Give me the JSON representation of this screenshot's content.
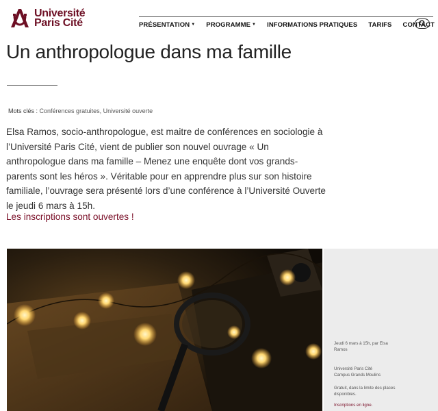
{
  "brand": {
    "line1": "Université",
    "line2": "Paris Cité",
    "color": "#6d0f24"
  },
  "nav": {
    "items": [
      {
        "label": "PRÉSENTATION",
        "caret": true
      },
      {
        "label": "PROGRAMME",
        "caret": true
      },
      {
        "label": "INFORMATIONS PRATIQUES",
        "caret": false
      },
      {
        "label": "TARIFS",
        "caret": false
      },
      {
        "label": "CONTACT",
        "caret": false
      }
    ],
    "search_icon": "search-icon"
  },
  "article": {
    "title": "Un anthropologue dans ma famille",
    "keywords_label": "Mots clés :",
    "keywords": "Conférences gratuites, Université ouverte",
    "intro": "Elsa Ramos, socio-anthropologue, est maitre de conférences en sociologie à l’Université Paris Cité, vient de publier son nouvel ouvrage « Un anthropologue dans ma famille – Menez une enquête dont vos grands-parents sont les héros ». Véritable pour en apprendre plus sur son histoire familiale, l’ouvrage sera présenté lors d’une conférence à l’Université Ouverte le jeudi 6 mars à 15h.",
    "cta": "Les inscriptions sont ouvertes !"
  },
  "sidebar": {
    "date": "Jeudi 6 mars à 15h, par Elsa Ramos",
    "place_line1": "Université Paris Cité",
    "place_line2": "Campus Grands Moulins",
    "free": "Gratuit, dans la limite des places disponibles.",
    "link": "Inscriptions en ligne."
  },
  "colors": {
    "accent": "#7a0f28",
    "sidebar_bg": "#ececec"
  }
}
